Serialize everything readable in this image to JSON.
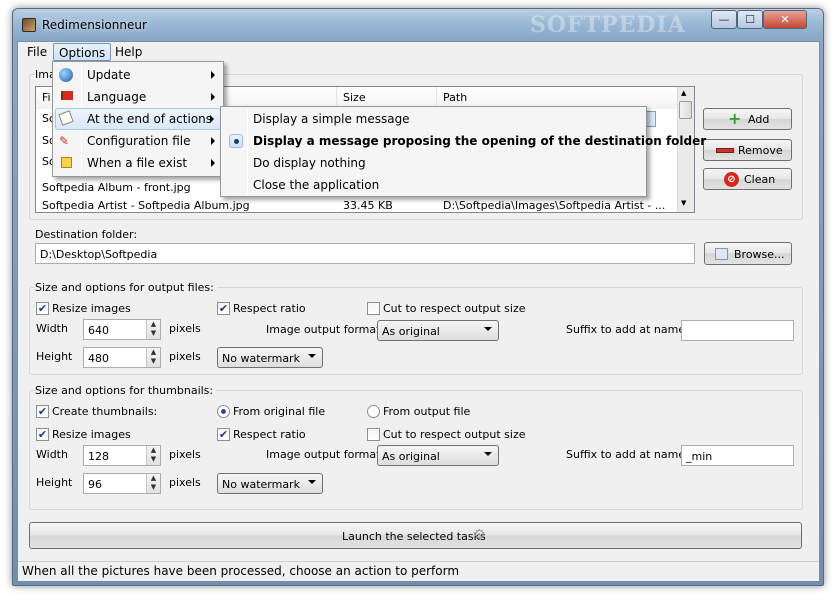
{
  "window": {
    "title": "Redimensionneur",
    "minimize_glyph": "—",
    "maximize_glyph": "☐",
    "close_glyph": "✕",
    "watermark": "SOFTPEDIA"
  },
  "menubar": {
    "file": "File",
    "options": "Options",
    "help": "Help"
  },
  "options_menu": {
    "items": [
      {
        "label": "Update",
        "icon": "globe-icon"
      },
      {
        "label": "Language",
        "icon": "flag-icon"
      },
      {
        "label": "At the end of actions",
        "icon": "tag-icon"
      },
      {
        "label": "Configuration file",
        "icon": "tools-icon"
      },
      {
        "label": "When a file exist",
        "icon": "warning-icon"
      }
    ]
  },
  "end_actions_submenu": {
    "items": [
      {
        "label": "Display a simple message",
        "selected": false
      },
      {
        "label": "Display a message proposing the opening of the destination folder",
        "selected": true
      },
      {
        "label": "Do display nothing",
        "selected": false
      },
      {
        "label": "Close the application",
        "selected": false
      }
    ]
  },
  "images_group": {
    "label_fragment": "Ima",
    "columns": [
      "Fi",
      "Size",
      "Path"
    ],
    "rows": [
      {
        "name": "So",
        "size": "",
        "path": ""
      },
      {
        "name": "So",
        "size": "",
        "path": ""
      },
      {
        "name": "So",
        "size": "",
        "path": ""
      },
      {
        "name": "Softpedia Album - front.jpg",
        "size": "",
        "path": ""
      },
      {
        "name": "Softpedia Artist - Softpedia Album.jpg",
        "size": "33.45 KB",
        "path": "D:\\Softpedia\\Images\\Softpedia Artist - ..."
      }
    ],
    "add_label": "Add",
    "remove_label": "Remove",
    "clean_label": "Clean"
  },
  "destination": {
    "label": "Destination folder:",
    "value": "D:\\Desktop\\Softpedia",
    "browse_label": "Browse..."
  },
  "output_files": {
    "label": "Size and options for output files:",
    "resize_label": "Resize images",
    "resize_checked": true,
    "ratio_label": "Respect ratio",
    "ratio_checked": true,
    "cut_label": "Cut to respect output size",
    "cut_checked": false,
    "width_label": "Width",
    "width_value": "640",
    "height_label": "Height",
    "height_value": "480",
    "px_label": "pixels",
    "format_label": "Image output format:",
    "format_value": "As original",
    "watermark_value": "No watermark",
    "suffix_label": "Suffix to add at name:",
    "suffix_value": ""
  },
  "thumbnails": {
    "label": "Size and options for thumbnails:",
    "create_label": "Create thumbnails:",
    "create_checked": true,
    "from_original_label": "From original file",
    "from_output_label": "From output file",
    "resize_label": "Resize images",
    "ratio_label": "Respect ratio",
    "cut_label": "Cut to respect output size",
    "width_label": "Width",
    "width_value": "128",
    "height_label": "Height",
    "height_value": "96",
    "px_label": "pixels",
    "format_label": "Image output format:",
    "format_value": "As original",
    "watermark_value": "No watermark",
    "suffix_label": "Suffix to add at name:",
    "suffix_value": "_min"
  },
  "launch_label": "Launch the selected tasks",
  "status_text": "When all the pictures have been processed, choose an action to perform",
  "check_glyph": "✔",
  "colors": {
    "add_green": "#2fa42f",
    "remove_red": "#c0392b",
    "clean_red": "#d7261f",
    "menu_highlight": "#cfe2f6"
  }
}
